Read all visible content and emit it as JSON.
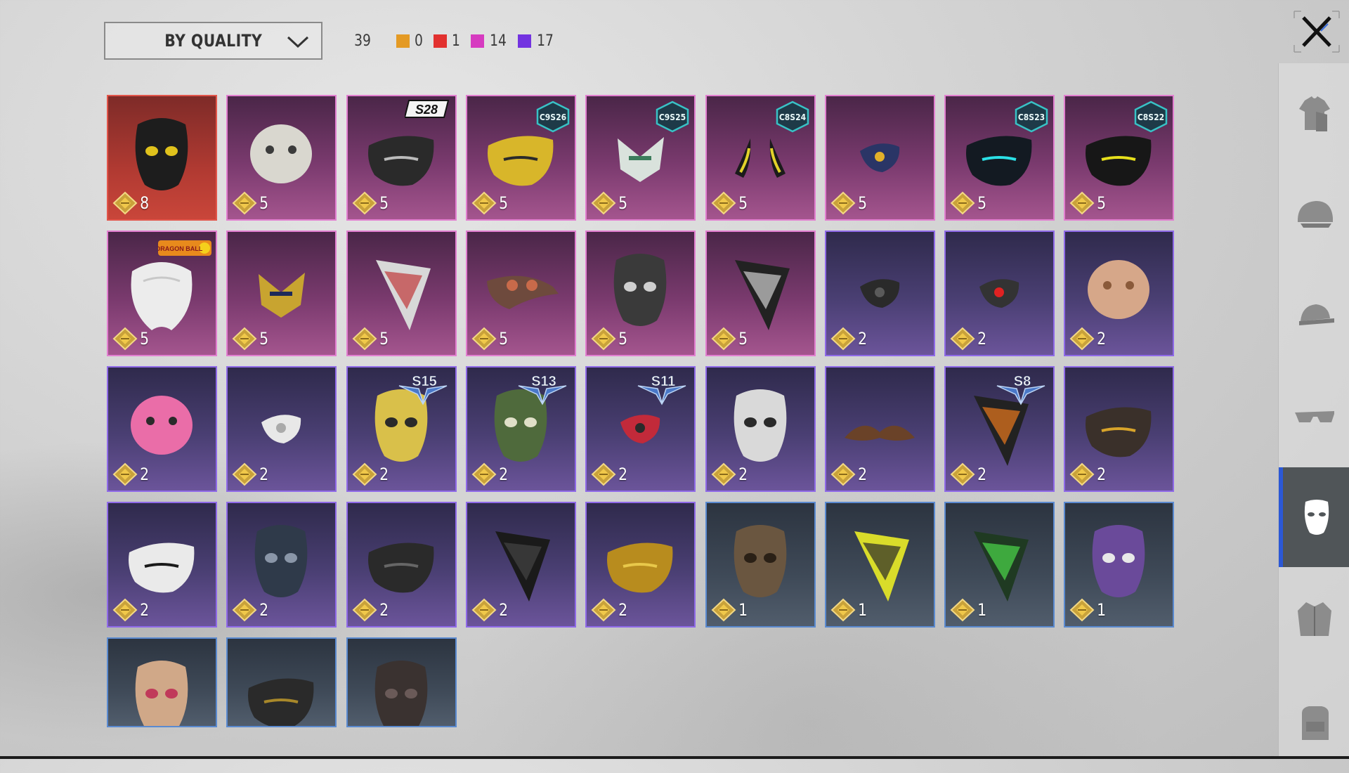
{
  "toolbar": {
    "sort_label": "BY QUALITY",
    "total_count": "39",
    "quality_counts": [
      {
        "color": "#e49a24",
        "count": "0"
      },
      {
        "color": "#e2312f",
        "count": "1"
      },
      {
        "color": "#d63bc0",
        "count": "14"
      },
      {
        "color": "#7333e0",
        "count": "17"
      }
    ]
  },
  "colors": {
    "red_quality": "#e2554a",
    "pink_quality": "#e27fd0",
    "purple_quality": "#8f6ae8",
    "blue_quality": "#5a8ad0",
    "active_tab": "#2b58d6"
  },
  "items": [
    {
      "quality": "red",
      "cost": "8",
      "icon": "gas-mask-yellow-lenses-icon",
      "badge": ""
    },
    {
      "quality": "pink",
      "cost": "5",
      "icon": "cat-face-mask-icon",
      "badge": ""
    },
    {
      "quality": "pink",
      "cost": "5",
      "icon": "black-gold-face-mask-icon",
      "badge": "S28",
      "badge_type": "season"
    },
    {
      "quality": "pink",
      "cost": "5",
      "icon": "yellow-hex-mask-icon",
      "badge": "C9S26",
      "badge_type": "hex"
    },
    {
      "quality": "pink",
      "cost": "5",
      "icon": "green-spike-mask-icon",
      "badge": "C9S25",
      "badge_type": "hex"
    },
    {
      "quality": "pink",
      "cost": "5",
      "icon": "yellow-horn-mask-icon",
      "badge": "C8S24",
      "badge_type": "hex"
    },
    {
      "quality": "pink",
      "cost": "5",
      "icon": "blue-tech-mask-icon",
      "badge": ""
    },
    {
      "quality": "pink",
      "cost": "5",
      "icon": "neon-cyan-mask-icon",
      "badge": "C8S23",
      "badge_type": "hex"
    },
    {
      "quality": "pink",
      "cost": "5",
      "icon": "black-ring-mask-icon",
      "badge": "C8S22",
      "badge_type": "hex"
    },
    {
      "quality": "pink",
      "cost": "5",
      "icon": "white-beard-mask-icon",
      "badge": "DRAGON BALL",
      "badge_type": "logo"
    },
    {
      "quality": "pink",
      "cost": "5",
      "icon": "gold-armor-mask-icon",
      "badge": ""
    },
    {
      "quality": "pink",
      "cost": "5",
      "icon": "skull-bandana-red-icon",
      "badge": ""
    },
    {
      "quality": "pink",
      "cost": "5",
      "icon": "plague-doctor-mask-icon",
      "badge": ""
    },
    {
      "quality": "pink",
      "cost": "5",
      "icon": "striped-full-mask-icon",
      "badge": ""
    },
    {
      "quality": "pink",
      "cost": "5",
      "icon": "skull-bandana-black-icon",
      "badge": ""
    },
    {
      "quality": "purple",
      "cost": "2",
      "icon": "black-half-mask-icon",
      "badge": ""
    },
    {
      "quality": "purple",
      "cost": "2",
      "icon": "red-eye-visor-icon",
      "badge": ""
    },
    {
      "quality": "purple",
      "cost": "2",
      "icon": "mammoth-mask-icon",
      "badge": ""
    },
    {
      "quality": "purple",
      "cost": "2",
      "icon": "pink-creature-mask-icon",
      "badge": ""
    },
    {
      "quality": "purple",
      "cost": "2",
      "icon": "white-half-mask-icon",
      "badge": ""
    },
    {
      "quality": "purple",
      "cost": "2",
      "icon": "gold-skull-helmet-icon",
      "badge": "S15",
      "badge_type": "wing"
    },
    {
      "quality": "purple",
      "cost": "2",
      "icon": "goggle-helmet-icon",
      "badge": "S13",
      "badge_type": "wing"
    },
    {
      "quality": "purple",
      "cost": "2",
      "icon": "red-small-mask-icon",
      "badge": "S11",
      "badge_type": "wing"
    },
    {
      "quality": "purple",
      "cost": "2",
      "icon": "robot-helmet-icon",
      "badge": ""
    },
    {
      "quality": "purple",
      "cost": "2",
      "icon": "mustache-icon",
      "badge": ""
    },
    {
      "quality": "purple",
      "cost": "2",
      "icon": "flame-bandana-icon",
      "badge": "S8",
      "badge_type": "wing"
    },
    {
      "quality": "purple",
      "cost": "2",
      "icon": "studded-gold-mask-icon",
      "badge": ""
    },
    {
      "quality": "purple",
      "cost": "2",
      "icon": "black-white-face-mask-icon",
      "badge": ""
    },
    {
      "quality": "purple",
      "cost": "2",
      "icon": "dark-skull-mask-icon",
      "badge": ""
    },
    {
      "quality": "purple",
      "cost": "2",
      "icon": "grill-mask-icon",
      "badge": ""
    },
    {
      "quality": "purple",
      "cost": "2",
      "icon": "black-bandana-icon",
      "badge": ""
    },
    {
      "quality": "purple",
      "cost": "2",
      "icon": "gold-sequin-mask-icon",
      "badge": ""
    },
    {
      "quality": "blue",
      "cost": "1",
      "icon": "sackcloth-mask-icon",
      "badge": ""
    },
    {
      "quality": "blue",
      "cost": "1",
      "icon": "yellow-dotted-bandana-icon",
      "badge": ""
    },
    {
      "quality": "blue",
      "cost": "1",
      "icon": "green-web-bandana-icon",
      "badge": ""
    },
    {
      "quality": "blue",
      "cost": "1",
      "icon": "purple-theatre-mask-icon",
      "badge": ""
    },
    {
      "quality": "blue",
      "cost": "",
      "icon": "pink-theatre-mask-icon",
      "badge": ""
    },
    {
      "quality": "blue",
      "cost": "",
      "icon": "ornate-face-mask-icon",
      "badge": ""
    },
    {
      "quality": "blue",
      "cost": "",
      "icon": "respirator-mask-icon",
      "badge": ""
    }
  ],
  "sidebar": [
    {
      "name": "shirt-icon",
      "active": false
    },
    {
      "name": "helmet-icon",
      "active": false
    },
    {
      "name": "cap-icon",
      "active": false
    },
    {
      "name": "glasses-icon",
      "active": false
    },
    {
      "name": "mask-icon",
      "active": true
    },
    {
      "name": "jacket-icon",
      "active": false
    },
    {
      "name": "backpack-icon",
      "active": false
    }
  ]
}
